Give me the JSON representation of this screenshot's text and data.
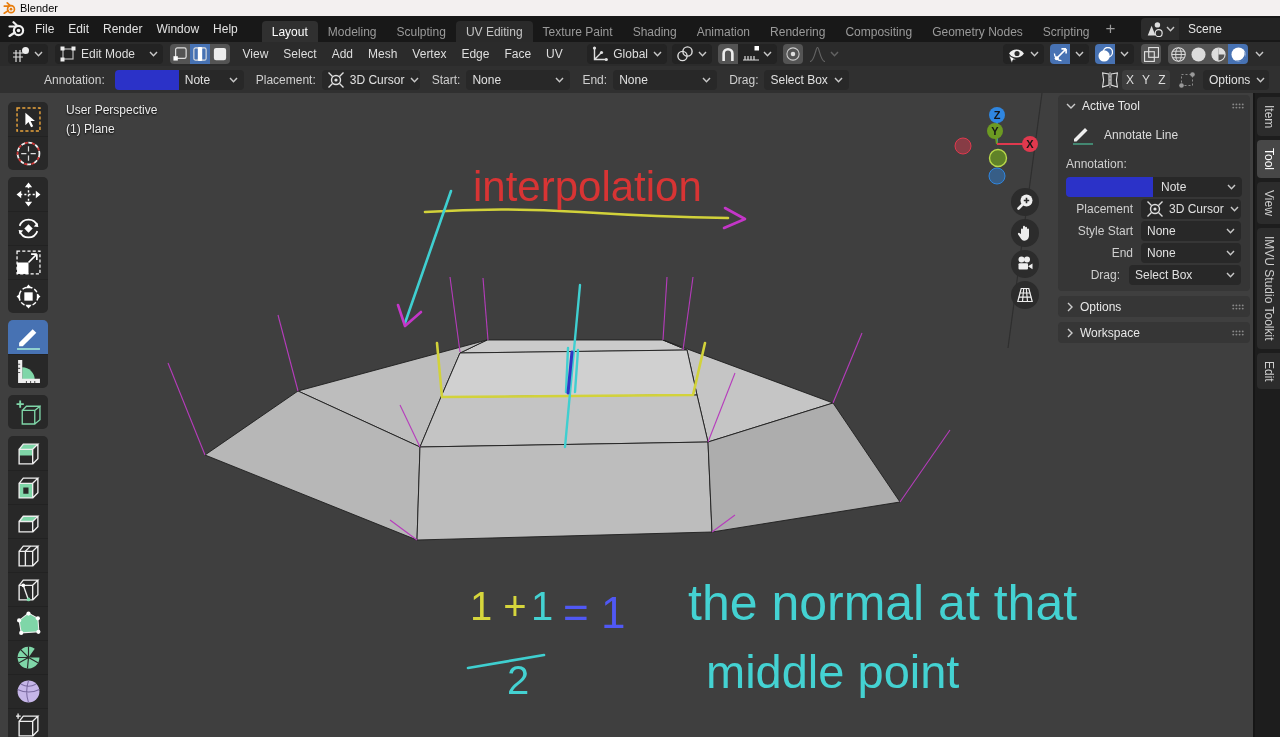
{
  "window": {
    "title": "Blender"
  },
  "topbar": {
    "menus": [
      "File",
      "Edit",
      "Render",
      "Window",
      "Help"
    ],
    "workspaces": [
      {
        "label": "Layout",
        "selected": true,
        "highlighted": false
      },
      {
        "label": "Modeling",
        "selected": false,
        "highlighted": false
      },
      {
        "label": "Sculpting",
        "selected": false,
        "highlighted": false
      },
      {
        "label": "UV Editing",
        "selected": false,
        "highlighted": true
      },
      {
        "label": "Texture Paint",
        "selected": false,
        "highlighted": false
      },
      {
        "label": "Shading",
        "selected": false,
        "highlighted": false
      },
      {
        "label": "Animation",
        "selected": false,
        "highlighted": false
      },
      {
        "label": "Rendering",
        "selected": false,
        "highlighted": false
      },
      {
        "label": "Compositing",
        "selected": false,
        "highlighted": false
      },
      {
        "label": "Geometry Nodes",
        "selected": false,
        "highlighted": false
      },
      {
        "label": "Scripting",
        "selected": false,
        "highlighted": false
      }
    ],
    "add_workspace": "+",
    "scene": "Scene"
  },
  "header": {
    "mode": "Edit Mode",
    "select_modes": [
      {
        "kind": "vertex",
        "selected": false
      },
      {
        "kind": "edge",
        "selected": true
      },
      {
        "kind": "face",
        "selected": false
      }
    ],
    "menus": [
      "View",
      "Select",
      "Add",
      "Mesh",
      "Vertex",
      "Edge",
      "Face",
      "UV"
    ],
    "orientation": "Global",
    "snap": {
      "on": false
    },
    "proportional_editing": {
      "on": false
    },
    "falloff": {
      "disabled": true
    },
    "gizmos": {
      "on": true
    },
    "overlays": {
      "on": true
    },
    "xray": {
      "on": false
    },
    "shading": [
      {
        "kind": "wireframe",
        "selected": false
      },
      {
        "kind": "solid",
        "selected": false
      },
      {
        "kind": "material",
        "selected": false
      },
      {
        "kind": "rendered",
        "selected": true
      }
    ]
  },
  "tool_settings": {
    "annotation": {
      "label": "Annotation:",
      "color": "#2b32c8",
      "layer": "Note"
    },
    "fields": [
      {
        "label": "Placement:",
        "value": "3D Cursor",
        "kind": "cursor"
      },
      {
        "label": "Start:",
        "value": "None",
        "kind": "plain"
      },
      {
        "label": "End:",
        "value": "None",
        "kind": "plain"
      },
      {
        "label": "Drag:",
        "value": "Select Box",
        "kind": "compact"
      }
    ],
    "mirror_axes": [
      {
        "label": "X",
        "on": false
      },
      {
        "label": "Y",
        "on": false
      },
      {
        "label": "Z",
        "on": false
      }
    ],
    "options": "Options"
  },
  "toolbar": {
    "groups": [
      {
        "tools": [
          {
            "kind": "select_box",
            "selected": false
          },
          {
            "kind": "cursor",
            "selected": false
          }
        ]
      },
      {
        "tools": [
          {
            "kind": "move",
            "selected": false
          },
          {
            "kind": "rotate",
            "selected": false
          },
          {
            "kind": "scale",
            "selected": false
          },
          {
            "kind": "transform",
            "selected": false
          }
        ]
      },
      {
        "tools": [
          {
            "kind": "annotate",
            "selected": true
          },
          {
            "kind": "measure",
            "selected": false
          }
        ]
      },
      {
        "tools": [
          {
            "kind": "add_cube",
            "selected": false
          }
        ]
      },
      {
        "tools": [
          {
            "kind": "extrude",
            "selected": false
          },
          {
            "kind": "inset",
            "selected": false
          },
          {
            "kind": "bevel",
            "selected": false
          },
          {
            "kind": "loop_cut",
            "selected": false
          },
          {
            "kind": "knife",
            "selected": false
          },
          {
            "kind": "poly_build",
            "selected": false
          },
          {
            "kind": "spin",
            "selected": false
          },
          {
            "kind": "smooth",
            "selected": false
          },
          {
            "kind": "shear",
            "selected": false
          }
        ]
      }
    ]
  },
  "viewport": {
    "view_name": "User Perspective",
    "object_name": "(1) Plane",
    "axes": [
      {
        "label": "Z",
        "color": "#2f86e0"
      },
      {
        "label": "Y",
        "color": "#6c9a22"
      },
      {
        "label": "X",
        "color": "#e0394e"
      }
    ],
    "annotations": [
      {
        "text": "interpolation",
        "color": "#d83434"
      },
      {
        "text": "1 +",
        "color": "#d6d63c"
      },
      {
        "text": "1",
        "color": "#44d2d2"
      },
      {
        "text": "2",
        "color": "#44d2d2"
      },
      {
        "text": "= 1",
        "color": "#5058f4"
      },
      {
        "text": "the normal at that",
        "color": "#44d2d2"
      },
      {
        "text": "middle point",
        "color": "#44d2d2"
      }
    ]
  },
  "sidebar": {
    "panels": [
      {
        "title": "Active Tool",
        "expanded": true,
        "tool": "Annotate Line",
        "annotation_label": "Annotation:",
        "color": "#2b32c8",
        "layer": "Note",
        "fields": [
          {
            "label": "Placement",
            "value": "3D Cursor",
            "kind": "cursor"
          },
          {
            "label": "Style Start",
            "value": "None",
            "kind": "plain"
          },
          {
            "label": "End",
            "value": "None",
            "kind": "plain"
          },
          {
            "label": "Drag:",
            "value": "Select Box",
            "kind": "compact"
          }
        ]
      },
      {
        "title": "Options",
        "expanded": false
      },
      {
        "title": "Workspace",
        "expanded": false
      }
    ],
    "tabs": [
      {
        "label": "Item",
        "selected": false
      },
      {
        "label": "Tool",
        "selected": true
      },
      {
        "label": "View",
        "selected": false
      },
      {
        "label": "IMVU Studio Toolkit",
        "selected": false
      },
      {
        "label": "Edit",
        "selected": false
      }
    ]
  }
}
